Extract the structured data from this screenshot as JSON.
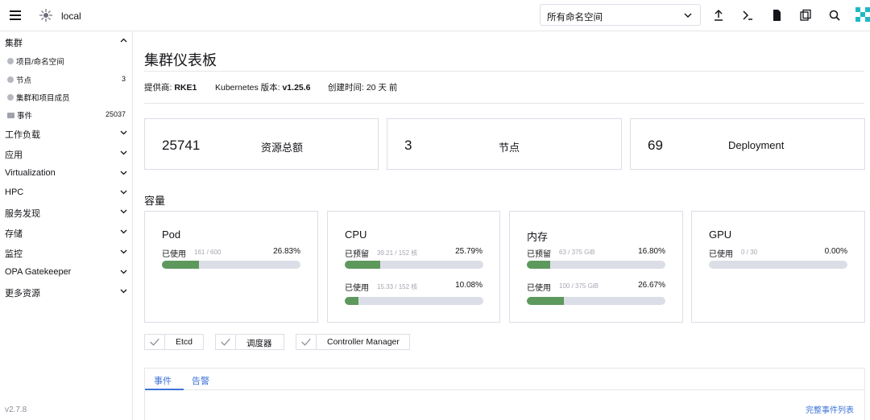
{
  "header": {
    "cluster_name": "local",
    "namespace_select": "所有命名空间",
    "icons": [
      "upload-icon",
      "terminal-icon",
      "file-icon",
      "copy-icon",
      "search-icon"
    ]
  },
  "sidebar": {
    "groups": [
      {
        "label": "集群",
        "expanded": true
      },
      {
        "label": "工作负载"
      },
      {
        "label": "应用"
      },
      {
        "label": "Virtualization"
      },
      {
        "label": "HPC"
      },
      {
        "label": "服务发现"
      },
      {
        "label": "存储"
      },
      {
        "label": "监控"
      },
      {
        "label": "OPA Gatekeeper"
      },
      {
        "label": "更多资源"
      }
    ],
    "cluster_items": [
      {
        "label": "项目/命名空间",
        "count": ""
      },
      {
        "label": "节点",
        "count": "3"
      },
      {
        "label": "集群和项目成员",
        "count": ""
      },
      {
        "label": "事件",
        "count": "25037"
      }
    ],
    "version": "v2.7.8"
  },
  "main": {
    "title": "集群仪表板",
    "meta": {
      "provider_label": "提供商: ",
      "provider_value": "RKE1",
      "k8s_label": "Kubernetes 版本: ",
      "k8s_value": "v1.25.6",
      "created_label": "创建时间: ",
      "created_value": "20 天 前"
    },
    "stats": [
      {
        "value": "25741",
        "label": "资源总额"
      },
      {
        "value": "3",
        "label": "节点"
      },
      {
        "value": "69",
        "label": "Deployment"
      }
    ],
    "capacity_title": "容量",
    "capacity": [
      {
        "name": "Pod",
        "gauges": [
          {
            "label": "已使用",
            "detail": "161 / 600",
            "pct": "26.83%",
            "fraction": 0.2683
          }
        ]
      },
      {
        "name": "CPU",
        "gauges": [
          {
            "label": "已预留",
            "detail": "39.21 / 152 核",
            "pct": "25.79%",
            "fraction": 0.2579
          },
          {
            "label": "已使用",
            "detail": "15.33 / 152 核",
            "pct": "10.08%",
            "fraction": 0.1008
          }
        ]
      },
      {
        "name": "内存",
        "gauges": [
          {
            "label": "已预留",
            "detail": "63 / 375 GiB",
            "pct": "16.80%",
            "fraction": 0.168
          },
          {
            "label": "已使用",
            "detail": "100 / 375 GiB",
            "pct": "26.67%",
            "fraction": 0.2667
          }
        ]
      },
      {
        "name": "GPU",
        "gauges": [
          {
            "label": "已使用",
            "detail": "0 / 30",
            "pct": "0.00%",
            "fraction": 0
          }
        ]
      }
    ],
    "components": [
      "Etcd",
      "调度器",
      "Controller Manager"
    ],
    "tabs": [
      {
        "label": "事件",
        "active": true
      },
      {
        "label": "告警",
        "active": false
      }
    ],
    "full_events_link": "完整事件列表"
  },
  "colors": {
    "accent": "#3d73d9",
    "gauge_fill": "#5d995d",
    "gauge_track": "#dcdee7",
    "border": "#dcdee7"
  }
}
